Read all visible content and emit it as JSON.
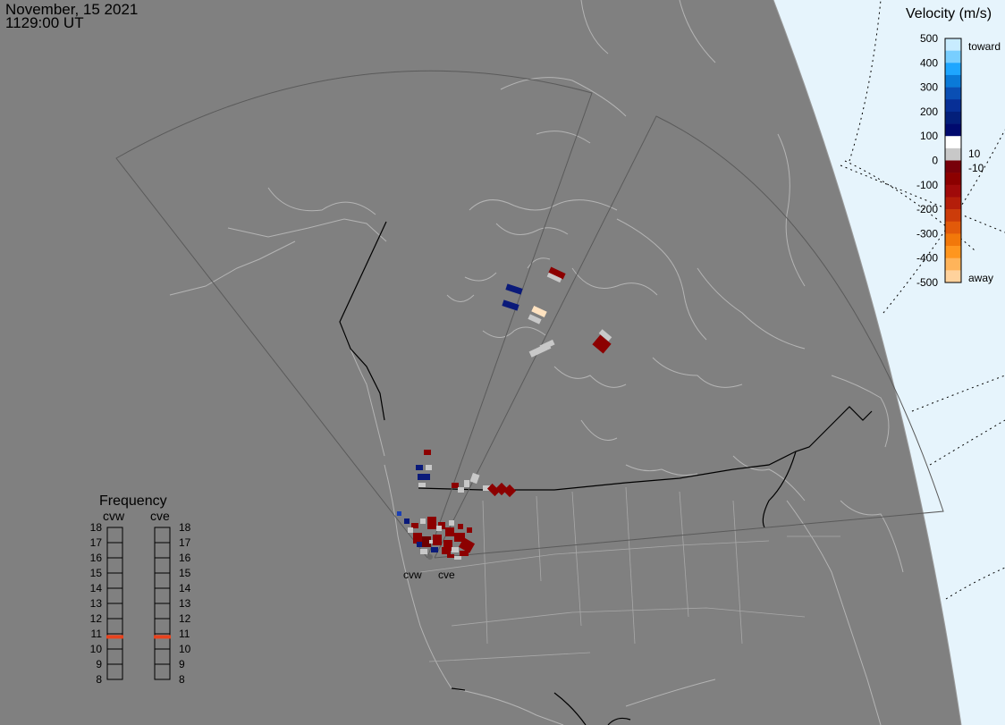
{
  "header": {
    "date": "November, 15 2021",
    "time": "1129:00 UT"
  },
  "colors": {
    "background": "#808080",
    "daylight": "#e6f4fc",
    "coast": "#b4b4b4",
    "fov": "#5a5a5a",
    "border": "#000000",
    "frequency_marker": "#e8431e",
    "ground_scatter": "#c8c8c8"
  },
  "radars": [
    {
      "id": "cvw",
      "label": "cvw"
    },
    {
      "id": "cve",
      "label": "cve"
    }
  ],
  "velocity_scale": {
    "title": "Velocity (m/s)",
    "toward_label": "toward",
    "away_label": "away",
    "ticks": [
      "500",
      "400",
      "300",
      "200",
      "100",
      "0",
      "-100",
      "-200",
      "-300",
      "-400",
      "-500"
    ],
    "threshold_pos": "10",
    "threshold_neg": "-10",
    "colors": [
      "#c8ecff",
      "#78ceff",
      "#1ea6ff",
      "#0a7ad8",
      "#0a4fb4",
      "#072f96",
      "#031f7a",
      "#000a6e",
      "#ffffff",
      "#c8c8c8",
      "#78000a",
      "#8c0000",
      "#a00a0a",
      "#b41e0a",
      "#cc3c0a",
      "#e25a0a",
      "#f2780a",
      "#ff961e",
      "#ffb45a",
      "#ffd29c"
    ]
  },
  "frequency_panel": {
    "title": "Frequency",
    "radars": [
      "cvw",
      "cve"
    ],
    "scale": [
      "18",
      "17",
      "16",
      "15",
      "14",
      "13",
      "12",
      "11",
      "10",
      "9",
      "8"
    ],
    "values_mhz": [
      10.8,
      10.8
    ]
  }
}
